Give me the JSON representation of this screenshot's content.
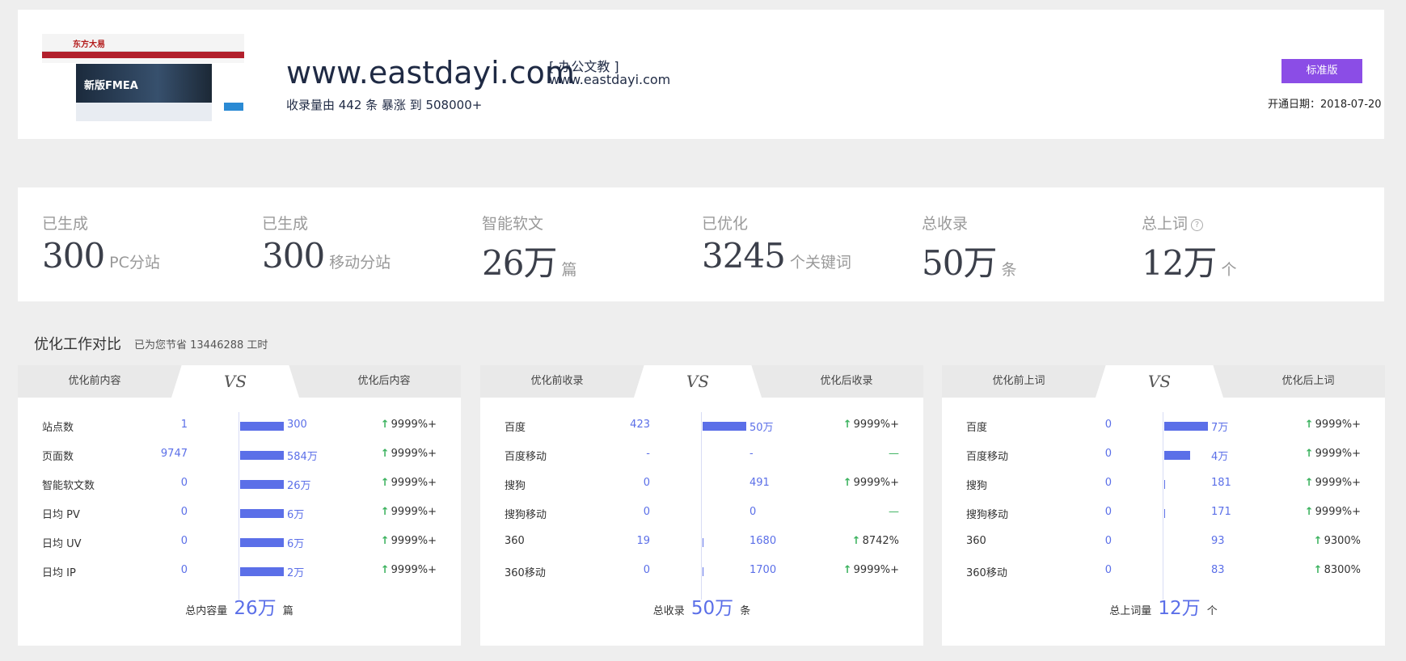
{
  "site": {
    "domain": "www.eastdayi.com",
    "category": "[ 办公文教 ]",
    "sub_domain": "www.eastdayi.com",
    "growth_text": "收录量由 442 条 暴涨 到 508000+",
    "version_label": "标准版",
    "open_date": "开通日期：2018-07-20",
    "thumb_logo": "东方大易",
    "thumb_banner": "新版FMEA"
  },
  "stats": [
    {
      "label": "已生成",
      "value": "300",
      "unit": "PC分站"
    },
    {
      "label": "已生成",
      "value": "300",
      "unit": "移动分站"
    },
    {
      "label": "智能软文",
      "value": "26万",
      "unit": "篇"
    },
    {
      "label": "已优化",
      "value": "3245",
      "unit": "个关键词"
    },
    {
      "label": "总收录",
      "value": "50万",
      "unit": "条"
    },
    {
      "label": "总上词",
      "value": "12万",
      "unit": "个",
      "help": "?"
    }
  ],
  "section": {
    "title": "优化工作对比",
    "subtitle": "已为您节省 13446288 工时"
  },
  "panels": [
    {
      "tab_left": "优化前内容",
      "vs": "VS",
      "tab_right": "优化后内容",
      "rows": [
        {
          "name": "站点数",
          "before": "1",
          "after": "300",
          "pct": "9999%+",
          "bar_fraction": 1.0
        },
        {
          "name": "页面数",
          "before": "9747",
          "after": "584万",
          "pct": "9999%+",
          "bar_fraction": 1.0
        },
        {
          "name": "智能软文数",
          "before": "0",
          "after": "26万",
          "pct": "9999%+",
          "bar_fraction": 1.0
        },
        {
          "name": "日均 PV",
          "before": "0",
          "after": "6万",
          "pct": "9999%+",
          "bar_fraction": 1.0
        },
        {
          "name": "日均 UV",
          "before": "0",
          "after": "6万",
          "pct": "9999%+",
          "bar_fraction": 1.0
        },
        {
          "name": "日均 IP",
          "before": "0",
          "after": "2万",
          "pct": "9999%+",
          "bar_fraction": 1.0
        }
      ],
      "total_label": "总内容量",
      "total_value": "26万",
      "total_unit": "篇"
    },
    {
      "tab_left": "优化前收录",
      "vs": "VS",
      "tab_right": "优化后收录",
      "rows": [
        {
          "name": "百度",
          "before": "423",
          "after": "50万",
          "pct": "9999%+",
          "bar_fraction": 1.0
        },
        {
          "name": "百度移动",
          "before": "-",
          "after": "-",
          "pct": "—",
          "bar_fraction": 0
        },
        {
          "name": "搜狗",
          "before": "0",
          "after": "491",
          "pct": "9999%+",
          "bar_fraction": 0
        },
        {
          "name": "搜狗移动",
          "before": "0",
          "after": "0",
          "pct": "—",
          "bar_fraction": 0
        },
        {
          "name": "360",
          "before": "19",
          "after": "1680",
          "pct": "8742%",
          "bar_fraction": 0.01
        },
        {
          "name": "360移动",
          "before": "0",
          "after": "1700",
          "pct": "9999%+",
          "bar_fraction": 0.01
        }
      ],
      "total_label": "总收录",
      "total_value": "50万",
      "total_unit": "条"
    },
    {
      "tab_left": "优化前上词",
      "vs": "VS",
      "tab_right": "优化后上词",
      "rows": [
        {
          "name": "百度",
          "before": "0",
          "after": "7万",
          "pct": "9999%+",
          "bar_fraction": 1.0
        },
        {
          "name": "百度移动",
          "before": "0",
          "after": "4万",
          "pct": "9999%+",
          "bar_fraction": 0.6
        },
        {
          "name": "搜狗",
          "before": "0",
          "after": "181",
          "pct": "9999%+",
          "bar_fraction": 0.01
        },
        {
          "name": "搜狗移动",
          "before": "0",
          "after": "171",
          "pct": "9999%+",
          "bar_fraction": 0.01
        },
        {
          "name": "360",
          "before": "0",
          "after": "93",
          "pct": "9300%",
          "bar_fraction": 0
        },
        {
          "name": "360移动",
          "before": "0",
          "after": "83",
          "pct": "8300%",
          "bar_fraction": 0
        }
      ],
      "total_label": "总上词量",
      "total_value": "12万",
      "total_unit": "个"
    }
  ],
  "colors": {
    "accent": "#5b6fe8",
    "up": "#3bb25e",
    "version": "#8b4de6"
  }
}
